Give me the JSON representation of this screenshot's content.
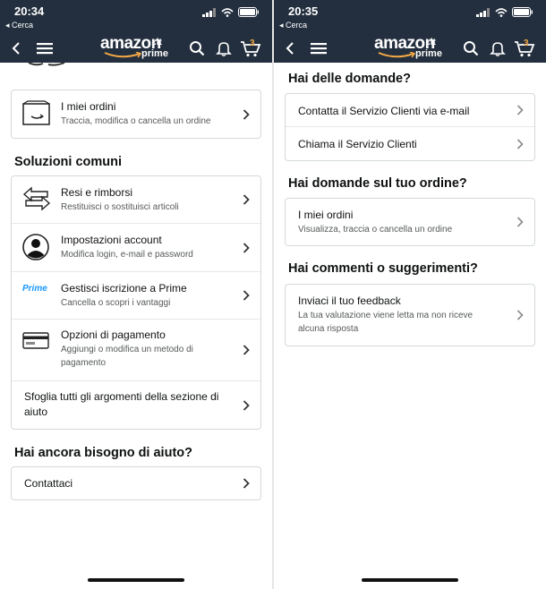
{
  "left": {
    "status": {
      "time": "20:34",
      "back_app": "◂ Cerca"
    },
    "header": {
      "logo_word": "amazon",
      "logo_tld": ".it",
      "logo_prime": "prime",
      "cart_count": "3"
    },
    "orders_card": {
      "title": "I miei ordini",
      "subtitle": "Traccia, modifica o cancella un ordine"
    },
    "common_title": "Soluzioni comuni",
    "common_items": [
      {
        "title": "Resi e rimborsi",
        "subtitle": "Restituisci o sostituisci articoli",
        "icon": "return-arrows-icon"
      },
      {
        "title": "Impostazioni account",
        "subtitle": "Modifica login, e-mail e password",
        "icon": "user-avatar-icon"
      },
      {
        "title": "Gestisci iscrizione a Prime",
        "subtitle": "Cancella o scopri i vantaggi",
        "icon": "prime-logo-icon",
        "icon_text": "Prime"
      },
      {
        "title": "Opzioni di pagamento",
        "subtitle_line1": "Aggiungi o modifica un metodo di",
        "subtitle_line2": "pagamento",
        "icon": "credit-card-icon"
      },
      {
        "title_line1": "Sfoglia tutti gli argomenti della sezione di",
        "title_line2": "aiuto"
      }
    ],
    "help_title": "Hai ancora bisogno di aiuto?",
    "contact": {
      "title": "Contattaci"
    }
  },
  "right": {
    "status": {
      "time": "20:35",
      "back_app": "◂ Cerca"
    },
    "header": {
      "logo_word": "amazon",
      "logo_tld": ".it",
      "logo_prime": "prime",
      "cart_count": "3"
    },
    "questions_title": "Hai delle domande?",
    "questions_items": [
      {
        "title": "Contatta il Servizio Clienti via e-mail"
      },
      {
        "title": "Chiama il Servizio Clienti"
      }
    ],
    "order_title": "Hai domande sul tuo ordine?",
    "order_item": {
      "title": "I miei ordini",
      "subtitle": "Visualizza, traccia o cancella un ordine"
    },
    "feedback_title": "Hai commenti o suggerimenti?",
    "feedback_item": {
      "title": "Inviaci il tuo feedback",
      "subtitle_line1": "La tua valutazione viene letta ma non riceve",
      "subtitle_line2": "alcuna risposta"
    }
  },
  "colors": {
    "header_bg": "#232f3e",
    "prime_blue": "#1a98ff",
    "cart_accent": "#f3a847"
  }
}
